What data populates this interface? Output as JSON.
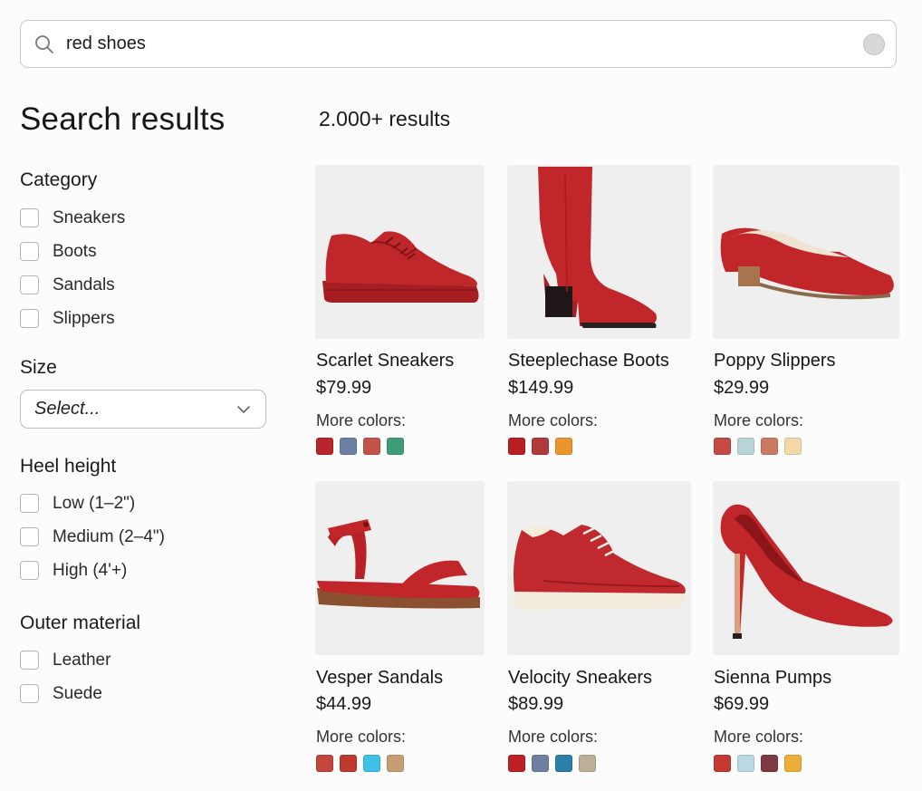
{
  "search": {
    "value": "red shoes",
    "icon": "search-icon",
    "clear_icon": "clear-icon"
  },
  "sidebar": {
    "title": "Search results",
    "category": {
      "title": "Category",
      "options": [
        "Sneakers",
        "Boots",
        "Sandals",
        "Slippers"
      ]
    },
    "size": {
      "title": "Size",
      "selected": "Select..."
    },
    "heel_height": {
      "title": "Heel height",
      "options": [
        "Low (1–2\")",
        "Medium (2–4\")",
        "High (4'+)"
      ]
    },
    "outer_material": {
      "title": "Outer material",
      "options": [
        "Leather",
        "Suede"
      ]
    }
  },
  "results": {
    "count": "2.000+ results",
    "more_colors_label": "More colors:",
    "products": [
      {
        "name": "Scarlet Sneakers",
        "price": "$79.99",
        "image": "suede-sneaker",
        "swatches": [
          "#b8252a",
          "#6a7fa3",
          "#c55248",
          "#3e9c78"
        ]
      },
      {
        "name": "Steeplechase Boots",
        "price": "$149.99",
        "image": "tall-boot",
        "swatches": [
          "#b81f22",
          "#b0393a",
          "#e9962d"
        ]
      },
      {
        "name": "Poppy Slippers",
        "price": "$29.99",
        "image": "flat-slipper",
        "swatches": [
          "#c44b44",
          "#b8d4d6",
          "#c97a60",
          "#f3d9a8"
        ]
      },
      {
        "name": "Vesper Sandals",
        "price": "$44.99",
        "image": "strap-sandal",
        "swatches": [
          "#c3463b",
          "#c0392f",
          "#3ec1e6",
          "#c59e72"
        ]
      },
      {
        "name": "Velocity Sneakers",
        "price": "$89.99",
        "image": "leather-sneaker",
        "swatches": [
          "#bf2024",
          "#6f7f9f",
          "#2c7fa8",
          "#bdb09a"
        ]
      },
      {
        "name": "Sienna Pumps",
        "price": "$69.99",
        "image": "heel-pump",
        "swatches": [
          "#c43a30",
          "#b8d8e6",
          "#7d3a44",
          "#ecae38"
        ]
      }
    ]
  }
}
